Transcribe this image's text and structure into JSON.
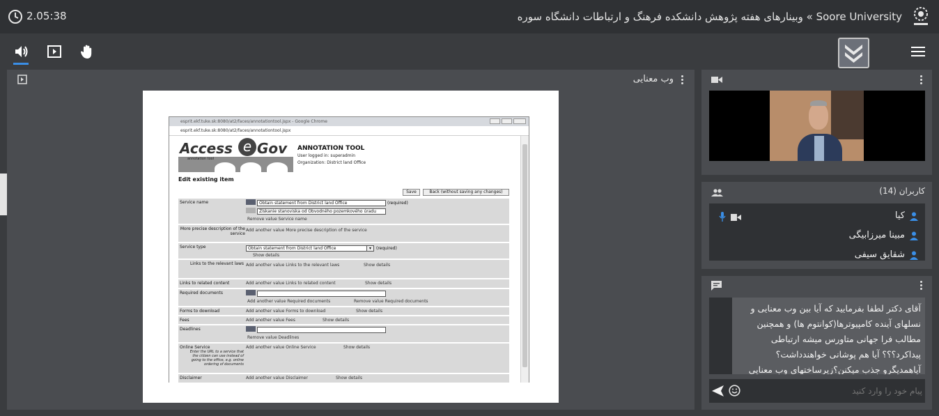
{
  "header": {
    "timer": "2.05:38",
    "title": "Soore University » وبینارهای هفته پژوهش دانشکده فرهنگ و ارتباطات دانشگاه سوره"
  },
  "presentation": {
    "title": "وب معنایی"
  },
  "browser": {
    "window_title": "esprit.ekf.tuke.sk:8080/at2/faces/annotationtool.jspx - Google Chrome",
    "address": "esprit.ekf.tuke.sk:8080/at2/faces/annotationtool.jspx",
    "logo_left": "Access",
    "logo_mid": "e",
    "logo_right": "Gov",
    "logo_sub": "annotation tool",
    "tool_title": "ANNOTATION TOOL",
    "user_line": "User logged in: superadmin",
    "org_line": "Organization: District land Office",
    "heading": "Edit existing item",
    "save_label": "Save",
    "back_label": "Back (without saving any changes)",
    "fields": {
      "service_name_label": "Service name",
      "service_name_en": "Obtain statement from District land Office",
      "required": "(required)",
      "service_name_sk": "Získanie stanoviska od Obvodného pozemkového úradu",
      "remove_service_name": "Remove value Service name",
      "precise_label": "More precise description of the service",
      "add_precise": "Add another value More precise description of the service",
      "service_type_label": "Service type",
      "service_type_value": "Obtain statement from District land Office",
      "show_details": "Show details",
      "links_relevant_label": "Links to the relevant laws",
      "links_relevant_italic": "Links to the relevant laws related to the service",
      "add_links_relevant": "Add another value Links to the relevant laws",
      "links_related_label": "Links to related content",
      "add_links_related": "Add another value Links to related content",
      "required_docs_label": "Required documents",
      "add_required_docs": "Add another value Required documents",
      "remove_required_docs": "Remove value Required documents",
      "forms_label": "Forms to download",
      "add_forms": "Add another value Forms to download",
      "fees_label": "Fees",
      "add_fees": "Add another value Fees",
      "deadlines_label": "Deadlines",
      "remove_deadlines": "Remove value Deadlines",
      "online_label": "Online Service",
      "online_italic": "Enter the URL to a service that the citizen can use instead of going to the office, e.g. online ordering of documents",
      "add_online": "Add another value Online Service",
      "disclaimer_label": "Disclaimer",
      "add_disclaimer": "Add another value Disclaimer"
    }
  },
  "users": {
    "header": "کاربران (14)",
    "list": [
      "کیا",
      "مبینا میرزابیگی",
      "شقایق سیفی"
    ]
  },
  "chat": {
    "lines": [
      "آقای دکتر لطفا بفرمایید که آیا بین وب معنایی و",
      "نسلهای آینده کامپیوترها(کوانتوم ها)  و همچنین",
      " مطالب فرا جهانی متاورس   میشه ارتباطی",
      "پیداکرد؟؟؟ آیا هم پوشانی خواهندداشت؟",
      "آیاهمدیگرو جذب میکنن؟زیرساختهای وب معنایی"
    ],
    "placeholder": "پیام خود را وارد کنید"
  },
  "colors": {
    "page_bg": "#3a3c3f",
    "topbar_bg": "#2f3134",
    "panel_bg": "#4a4c50",
    "accent_blue": "#3a8ee6"
  }
}
